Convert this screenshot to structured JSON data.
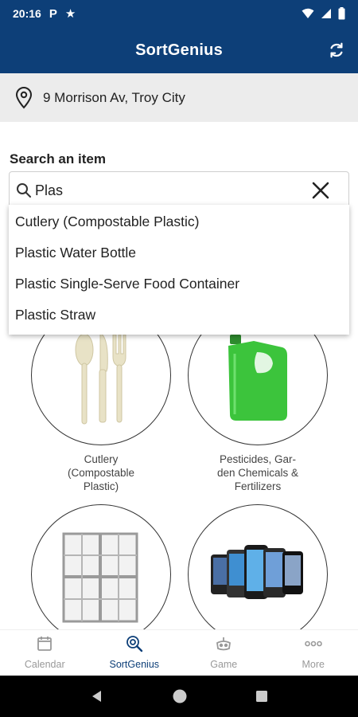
{
  "status_bar": {
    "time": "20:16"
  },
  "app_bar": {
    "title": "SortGenius"
  },
  "address": {
    "text": "9 Morrison Av, Troy City"
  },
  "search": {
    "label": "Search an item",
    "value": "Plas",
    "suggestions": [
      "Cutlery (Compostable Plastic)",
      "Plastic Water Bottle",
      "Plastic Single-Serve Food Container",
      "Plastic Straw"
    ]
  },
  "items": [
    {
      "label_line1": "Cutlery",
      "label_line2": "(Compostable",
      "label_line3": "Plastic)",
      "icon": "cutlery-image"
    },
    {
      "label_line1": "Pesticides, Gar-",
      "label_line2": "den Chemicals &",
      "label_line3": "Fertilizers",
      "icon": "chemical-jug-image"
    },
    {
      "label_line1": "",
      "label_line2": "",
      "label_line3": "",
      "icon": "window-image"
    },
    {
      "label_line1": "",
      "label_line2": "",
      "label_line3": "",
      "icon": "cell-phones-image"
    }
  ],
  "bottom_nav": [
    {
      "label": "Calendar",
      "icon": "calendar-icon",
      "active": false
    },
    {
      "label": "SortGenius",
      "icon": "search-globe-icon",
      "active": true
    },
    {
      "label": "Game",
      "icon": "game-icon",
      "active": false
    },
    {
      "label": "More",
      "icon": "more-icon",
      "active": false
    }
  ],
  "colors": {
    "primary": "#0d3f78",
    "address_bg": "#ececec",
    "inactive": "#999999"
  }
}
